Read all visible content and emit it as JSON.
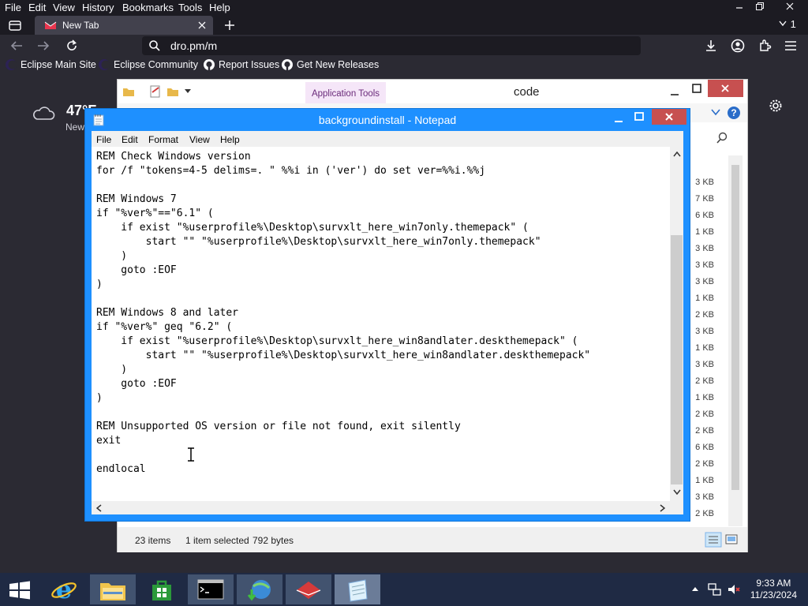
{
  "firefox": {
    "menu": [
      "File",
      "Edit",
      "View",
      "History",
      "Bookmarks",
      "Tools",
      "Help"
    ],
    "tab_title": "New Tab",
    "tab_count": "1",
    "url": "dro.pm/m",
    "bookmarks": [
      "Eclipse Main Site",
      "Eclipse Community",
      "Report Issues",
      "Get New Releases"
    ]
  },
  "weather": {
    "temp": "47°F",
    "location": "New"
  },
  "explorer": {
    "title": "code",
    "context_tab": "Application Tools",
    "sizes": [
      "3 KB",
      "7 KB",
      "6 KB",
      "1 KB",
      "3 KB",
      "3 KB",
      "3 KB",
      "1 KB",
      "2 KB",
      "3 KB",
      "1 KB",
      "3 KB",
      "2 KB",
      "1 KB",
      "2 KB",
      "2 KB",
      "6 KB",
      "2 KB",
      "1 KB",
      "3 KB",
      "2 KB"
    ],
    "status_items": "23 items",
    "status_selected": "1 item selected",
    "status_bytes": "792 bytes"
  },
  "notepad": {
    "title": "backgroundinstall - Notepad",
    "menu": [
      "File",
      "Edit",
      "Format",
      "View",
      "Help"
    ],
    "lines": [
      "REM Check Windows version",
      "for /f \"tokens=4-5 delims=. \" %%i in ('ver') do set ver=%%i.%%j",
      "",
      "REM Windows 7",
      "if \"%ver%\"==\"6.1\" (",
      "    if exist \"%userprofile%\\Desktop\\survxlt_here_win7only.themepack\" (",
      "        start \"\" \"%userprofile%\\Desktop\\survxlt_here_win7only.themepack\"",
      "    )",
      "    goto :EOF",
      ")",
      "",
      "REM Windows 8 and later",
      "if \"%ver%\" geq \"6.2\" (",
      "    if exist \"%userprofile%\\Desktop\\survxlt_here_win8andlater.deskthemepack\" (",
      "        start \"\" \"%userprofile%\\Desktop\\survxlt_here_win8andlater.deskthemepack\"",
      "    )",
      "    goto :EOF",
      ")",
      "",
      "REM Unsupported OS version or file not found, exit silently",
      "exit",
      "",
      "endlocal"
    ]
  },
  "taskbar": {
    "time": "9:33 AM",
    "date": "11/23/2024",
    "apps": [
      "internet-explorer",
      "file-explorer",
      "store",
      "command-prompt",
      "download-manager",
      "red-app",
      "notepad"
    ]
  },
  "colors": {
    "firefox_bg": "#1c1b22",
    "firefox_toolbar": "#2b2a33",
    "notepad_border": "#1e90ff",
    "taskbar": "#1f2a44"
  }
}
